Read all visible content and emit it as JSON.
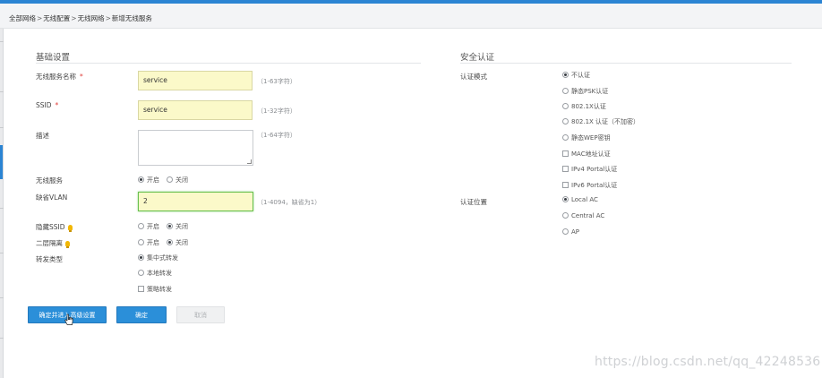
{
  "breadcrumb": [
    "全部网络",
    "无线配置",
    "无线网络",
    "新增无线服务"
  ],
  "breadcrumb_separator": ">",
  "basic": {
    "title": "基础设置",
    "service_name_label": "无线服务名称",
    "service_name_value": "service",
    "service_name_hint": "（1-63字符）",
    "ssid_label": "SSID",
    "ssid_value": "service",
    "ssid_hint": "（1-32字符）",
    "description_label": "描述",
    "description_value": "",
    "description_hint": "（1-64字符）",
    "wireless_service_label": "无线服务",
    "wireless_service_on": "开启",
    "wireless_service_off": "关闭",
    "default_vlan_label": "缺省VLAN",
    "default_vlan_value": "2",
    "default_vlan_hint": "（1-4094，缺省为1）",
    "hide_ssid_label": "隐藏SSID",
    "hide_ssid_on": "开启",
    "hide_ssid_off": "关闭",
    "l2_isolation_label": "二层隔离",
    "l2_isolation_on": "开启",
    "l2_isolation_off": "关闭",
    "forward_type_label": "转发类型",
    "forward_centralized": "集中式转发",
    "forward_local": "本地转发",
    "forward_policy": "策略转发",
    "required_mark": "*"
  },
  "security": {
    "title": "安全认证",
    "auth_mode_label": "认证模式",
    "auth_modes": [
      "不认证",
      "静态PSK认证",
      "802.1X认证",
      "802.1X 认证（不加密）",
      "静态WEP密钥"
    ],
    "auth_options": [
      "MAC地址认证",
      "IPv4 Portal认证",
      "IPv6 Portal认证"
    ],
    "auth_location_label": "认证位置",
    "auth_locations": [
      "Local AC",
      "Central AC",
      "AP"
    ]
  },
  "buttons": {
    "confirm_advanced": "确定并进入高级设置",
    "confirm": "确定",
    "cancel": "取消"
  },
  "watermark": "https://blog.csdn.net/qq_42248536",
  "colors": {
    "accent": "#2b84d3",
    "input_fill": "#fbf9c9",
    "required": "#e0413c"
  }
}
